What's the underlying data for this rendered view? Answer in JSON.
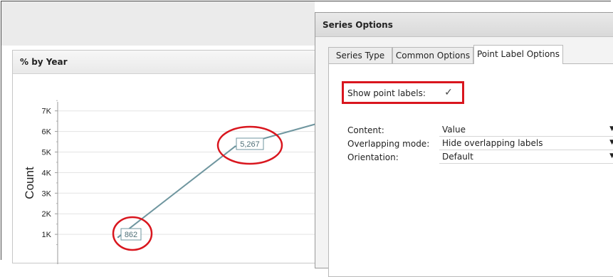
{
  "chart": {
    "title": "% by Year",
    "ylabel": "Count",
    "y_ticks": [
      "1K",
      "2K",
      "3K",
      "4K",
      "5K",
      "6K",
      "7K"
    ],
    "point_labels": [
      "862",
      "5,267"
    ],
    "line_color": "#6f969f",
    "highlight_color": "#d9161e"
  },
  "chart_data": {
    "type": "line",
    "title": "% by Year",
    "ylabel": "Count",
    "xlabel": "",
    "ylim": [
      0,
      7500
    ],
    "grid": true,
    "series": [
      {
        "values": [
          862,
          5267,
          6500
        ]
      }
    ]
  },
  "dialog": {
    "title": "Series Options",
    "tabs": [
      {
        "label": "Series Type",
        "active": false
      },
      {
        "label": "Common Options",
        "active": false
      },
      {
        "label": "Point Label Options",
        "active": true
      }
    ],
    "show_point_labels": {
      "label": "Show point labels:",
      "checked": true
    },
    "fields": [
      {
        "label": "Content:",
        "value": "Value"
      },
      {
        "label": "Overlapping mode:",
        "value": "Hide overlapping labels"
      },
      {
        "label": "Orientation:",
        "value": "Default"
      }
    ]
  },
  "icons": {
    "checkbox": "checkmark-icon",
    "dropdown": "chevron-down-icon"
  }
}
